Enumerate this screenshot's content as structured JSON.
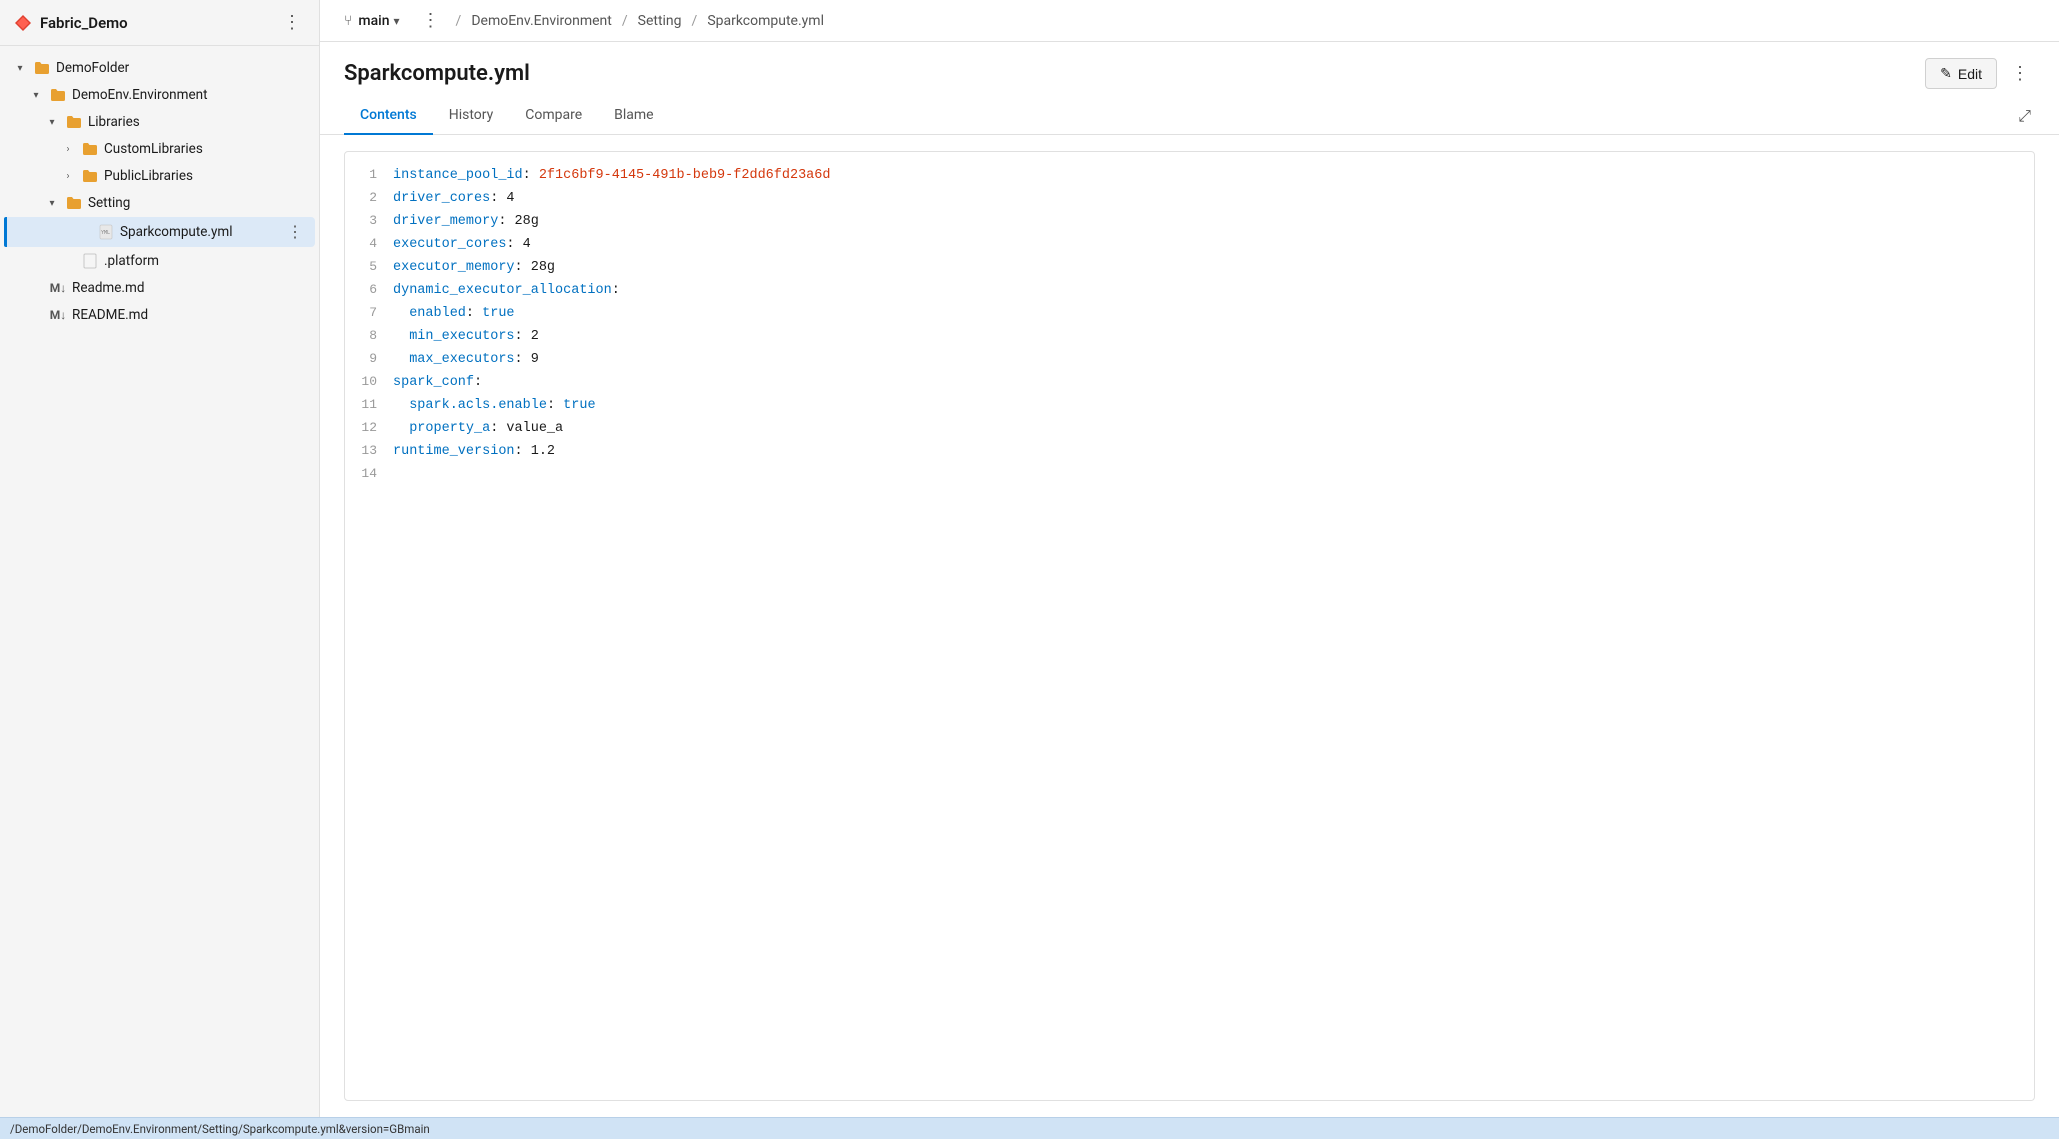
{
  "sidebar": {
    "title": "Fabric_Demo",
    "more_label": "⋮",
    "tree": [
      {
        "id": "demofolder",
        "label": "DemoFolder",
        "type": "folder",
        "indent": 0,
        "chevron": "down",
        "selected": false
      },
      {
        "id": "demoenv",
        "label": "DemoEnv.Environment",
        "type": "folder",
        "indent": 1,
        "chevron": "down",
        "selected": false
      },
      {
        "id": "libraries",
        "label": "Libraries",
        "type": "folder",
        "indent": 2,
        "chevron": "down",
        "selected": false
      },
      {
        "id": "customlibraries",
        "label": "CustomLibraries",
        "type": "folder",
        "indent": 3,
        "chevron": "right",
        "selected": false
      },
      {
        "id": "publiclibraries",
        "label": "PublicLibraries",
        "type": "folder",
        "indent": 3,
        "chevron": "right",
        "selected": false
      },
      {
        "id": "setting",
        "label": "Setting",
        "type": "folder",
        "indent": 2,
        "chevron": "down",
        "selected": false
      },
      {
        "id": "sparkcompute",
        "label": "Sparkcompute.yml",
        "type": "yml",
        "indent": 4,
        "chevron": "none",
        "selected": true,
        "has_more": true
      },
      {
        "id": "platform",
        "label": ".platform",
        "type": "file",
        "indent": 3,
        "chevron": "none",
        "selected": false
      },
      {
        "id": "readme-md",
        "label": "Readme.md",
        "type": "md",
        "indent": 1,
        "chevron": "none",
        "selected": false
      },
      {
        "id": "readme-MD",
        "label": "README.md",
        "type": "md",
        "indent": 1,
        "chevron": "none",
        "selected": false
      }
    ]
  },
  "topbar": {
    "branch_icon": "⑂",
    "branch_name": "main",
    "more_label": "⋮",
    "breadcrumbs": [
      "DemoEnv.Environment",
      "Setting",
      "Sparkcompute.yml"
    ]
  },
  "file": {
    "title": "Sparkcompute.yml",
    "edit_label": "Edit",
    "tabs": [
      "Contents",
      "History",
      "Compare",
      "Blame"
    ],
    "active_tab": "Contents"
  },
  "code": {
    "lines": [
      {
        "num": 1,
        "content": "instance_pool_id: 2f1c6bf9-4145-491b-beb9-f2dd6fd23a6d",
        "key": "instance_pool_id",
        "sep": ": ",
        "val": "2f1c6bf9-4145-491b-beb9-f2dd6fd23a6d",
        "val_type": "str"
      },
      {
        "num": 2,
        "content": "driver_cores: 4",
        "key": "driver_cores",
        "sep": ": ",
        "val": "4",
        "val_type": "num"
      },
      {
        "num": 3,
        "content": "driver_memory: 28g",
        "key": "driver_memory",
        "sep": ": ",
        "val": "28g",
        "val_type": "num"
      },
      {
        "num": 4,
        "content": "executor_cores: 4",
        "key": "executor_cores",
        "sep": ": ",
        "val": "4",
        "val_type": "num"
      },
      {
        "num": 5,
        "content": "executor_memory: 28g",
        "key": "executor_memory",
        "sep": ": ",
        "val": "28g",
        "val_type": "num"
      },
      {
        "num": 6,
        "content": "dynamic_executor_allocation:",
        "key": "dynamic_executor_allocation",
        "sep": ":",
        "val": "",
        "val_type": "none"
      },
      {
        "num": 7,
        "content": "  enabled: true",
        "key": "enabled",
        "sep": ": ",
        "val": "true",
        "val_type": "bool",
        "indent": "  "
      },
      {
        "num": 8,
        "content": "  min_executors: 2",
        "key": "min_executors",
        "sep": ": ",
        "val": "2",
        "val_type": "num",
        "indent": "  "
      },
      {
        "num": 9,
        "content": "  max_executors: 9",
        "key": "max_executors",
        "sep": ": ",
        "val": "9",
        "val_type": "num",
        "indent": "  "
      },
      {
        "num": 10,
        "content": "spark_conf:",
        "key": "spark_conf",
        "sep": ":",
        "val": "",
        "val_type": "none"
      },
      {
        "num": 11,
        "content": "  spark.acls.enable: true",
        "key": "spark.acls.enable",
        "sep": ": ",
        "val": "true",
        "val_type": "bool",
        "indent": "  "
      },
      {
        "num": 12,
        "content": "  property_a: value_a",
        "key": "property_a",
        "sep": ": ",
        "val": "value_a",
        "val_type": "num",
        "indent": "  "
      },
      {
        "num": 13,
        "content": "runtime_version: 1.2",
        "key": "runtime_version",
        "sep": ": ",
        "val": "1.2",
        "val_type": "num"
      },
      {
        "num": 14,
        "content": "",
        "key": "",
        "sep": "",
        "val": "",
        "val_type": "none"
      }
    ]
  },
  "status_bar": {
    "text": "/DemoFolder/DemoEnv.Environment/Setting/Sparkcompute.yml&version=GBmain"
  }
}
